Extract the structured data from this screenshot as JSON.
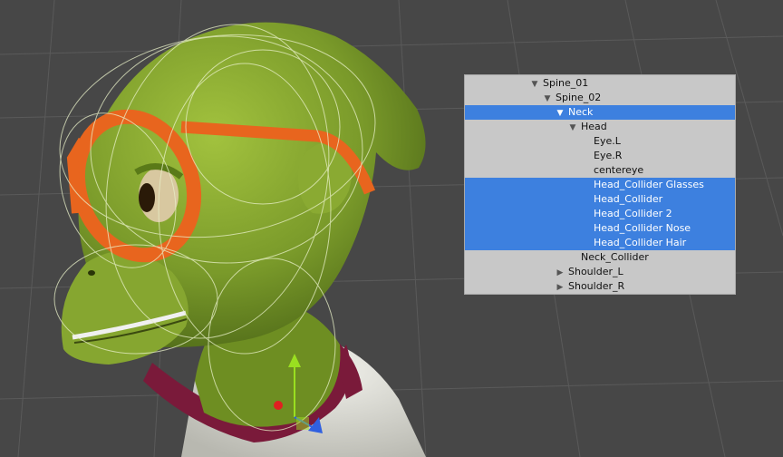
{
  "hierarchy": {
    "items": [
      {
        "label": "Spine_01",
        "depth": 0,
        "expander": "expanded",
        "selected": false
      },
      {
        "label": "Spine_02",
        "depth": 1,
        "expander": "expanded",
        "selected": false
      },
      {
        "label": "Neck",
        "depth": 2,
        "expander": "expanded",
        "selected": true
      },
      {
        "label": "Head",
        "depth": 3,
        "expander": "expanded",
        "selected": false
      },
      {
        "label": "Eye.L",
        "depth": 4,
        "expander": "none",
        "selected": false
      },
      {
        "label": "Eye.R",
        "depth": 4,
        "expander": "none",
        "selected": false
      },
      {
        "label": "centereye",
        "depth": 4,
        "expander": "none",
        "selected": false
      },
      {
        "label": "Head_Collider Glasses",
        "depth": 4,
        "expander": "none",
        "selected": true
      },
      {
        "label": "Head_Collider",
        "depth": 4,
        "expander": "none",
        "selected": true
      },
      {
        "label": "Head_Collider 2",
        "depth": 4,
        "expander": "none",
        "selected": true
      },
      {
        "label": "Head_Collider Nose",
        "depth": 4,
        "expander": "none",
        "selected": true
      },
      {
        "label": "Head_Collider Hair",
        "depth": 4,
        "expander": "none",
        "selected": true
      },
      {
        "label": "Neck_Collider",
        "depth": 3,
        "expander": "none",
        "selected": false
      },
      {
        "label": "Shoulder_L",
        "depth": 2,
        "expander": "collapsed",
        "selected": false
      },
      {
        "label": "Shoulder_R",
        "depth": 2,
        "expander": "collapsed",
        "selected": false
      }
    ]
  },
  "icons": {
    "expanded": "triangle-down-icon",
    "collapsed": "triangle-right-icon"
  },
  "colors": {
    "viewport_bg": "#474747",
    "grid": "#5a5a5a",
    "panel_bg": "#c8c8c8",
    "selection": "#3d80df",
    "skin": "#7a9a2a",
    "glasses": "#e8651e",
    "shirt": "#d8d8d0",
    "collar": "#7a1a3a",
    "gizmo_y": "#9adf20",
    "gizmo_z": "#3060e0",
    "gizmo_x": "#e02020"
  }
}
